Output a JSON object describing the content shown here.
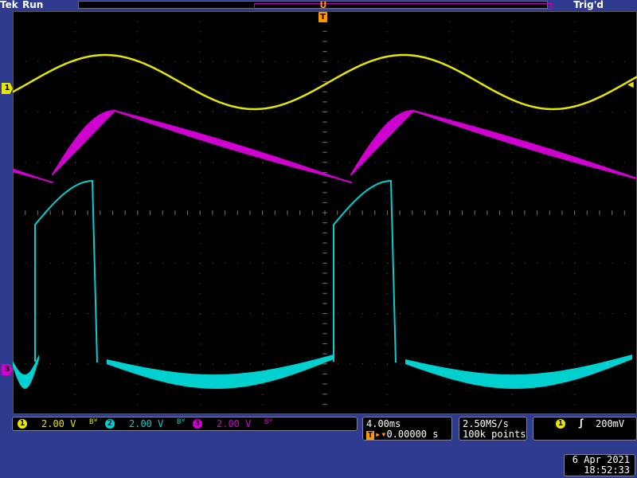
{
  "header": {
    "brand": "Tek",
    "acquisition_state": "Run",
    "trigger_status": "Trig'd"
  },
  "markers": {
    "ch1": "1",
    "ch3": "3",
    "trigger_position": "T",
    "trigger_top": "U"
  },
  "channels": [
    {
      "num": "1",
      "scale": "2.00 V",
      "color": "#e6e600"
    },
    {
      "num": "2",
      "scale": "2.00 V",
      "color": "#00d0d0"
    },
    {
      "num": "3",
      "scale": "2.00 V",
      "color": "#d000d0"
    }
  ],
  "bandwidth_icon": "Bᵂ",
  "horizontal": {
    "time_per_div": "4.00ms",
    "trigger_pos_label": "T",
    "trigger_pos_value": "0.00000 s"
  },
  "acquisition": {
    "sample_rate": "2.50MS/s",
    "record_length": "100k points"
  },
  "trigger": {
    "source": "1",
    "slope_icon": "rising-edge-icon",
    "slope_glyph": "ʃ",
    "level": "200mV"
  },
  "datetime": {
    "date": "6 Apr  2021",
    "time": "18:52:33"
  },
  "colors": {
    "ch1": "#e6e600",
    "ch2": "#00d0d0",
    "ch3": "#d000d0",
    "trigger": "#ff9900",
    "background": "#2e3b8f"
  }
}
